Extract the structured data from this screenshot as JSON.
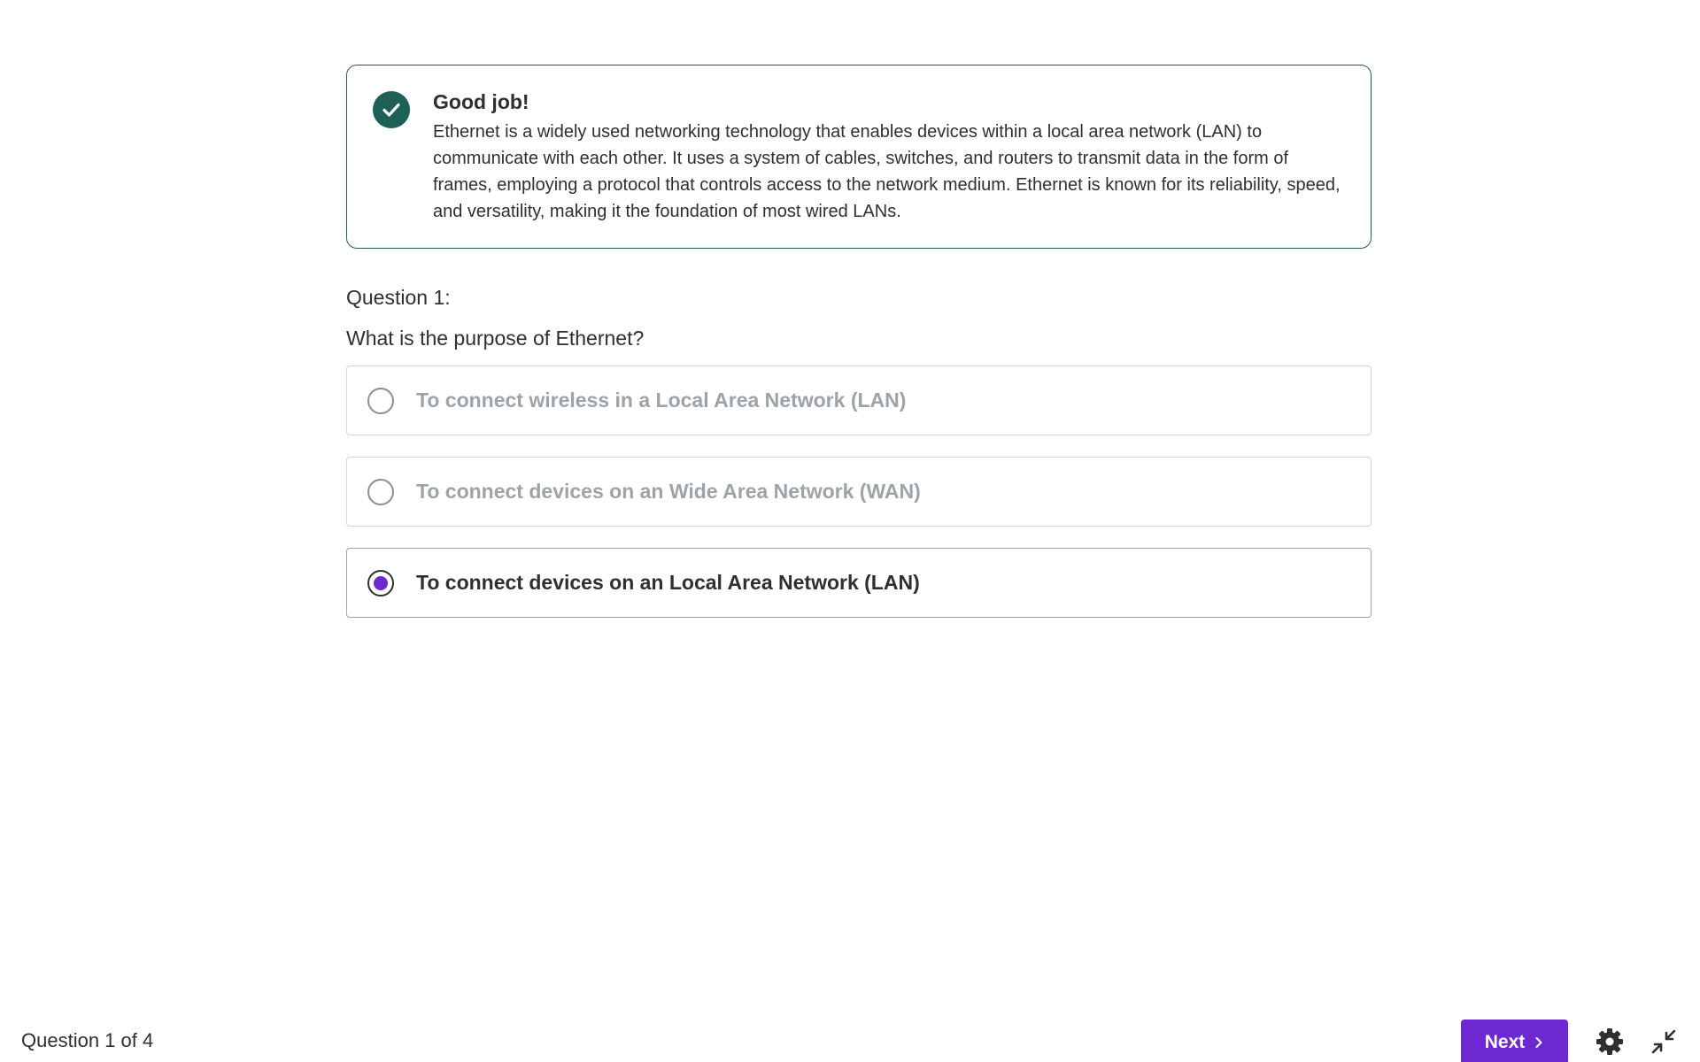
{
  "feedback": {
    "title": "Good job!",
    "body": "Ethernet is a widely used networking technology that enables devices within a local area network (LAN) to communicate with each other. It uses a system of cables, switches, and routers to transmit data in the form of frames, employing a protocol that controls access to the network medium. Ethernet is known for its reliability, speed, and versatility, making it the foundation of most wired LANs.",
    "icon": "check-circle-icon",
    "color": "#1e6055"
  },
  "question": {
    "label": "Question 1:",
    "text": "What is the purpose of Ethernet?"
  },
  "options": [
    {
      "label": "To connect wireless in a Local Area Network (LAN)",
      "selected": false
    },
    {
      "label": "To connect devices on an Wide Area Network (WAN)",
      "selected": false
    },
    {
      "label": "To connect devices on an Local Area Network (LAN)",
      "selected": true
    }
  ],
  "footer": {
    "progress": "Question 1 of 4",
    "next_label": "Next",
    "next_icon": "chevron-right-icon",
    "settings_icon": "gear-icon",
    "collapse_icon": "collapse-icon"
  },
  "colors": {
    "accent": "#6d28d2",
    "success": "#1e6055",
    "text": "#2d2f31",
    "muted": "#9da3a7"
  }
}
